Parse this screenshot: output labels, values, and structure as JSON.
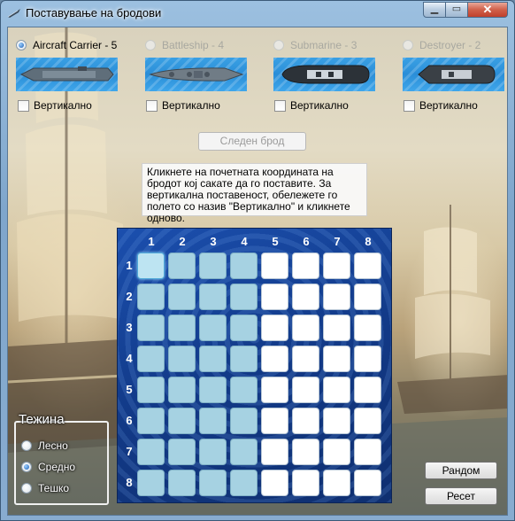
{
  "window": {
    "title": "Поставување на бродови",
    "min_label": "▁",
    "max_label": "▭",
    "close_label": "✕"
  },
  "ships": [
    {
      "label": "Aircraft Carrier - 5",
      "checked": true,
      "enabled": true,
      "vertical_label": "Вертикално"
    },
    {
      "label": "Battleship - 4",
      "checked": false,
      "enabled": false,
      "vertical_label": "Вертикално"
    },
    {
      "label": "Submarine - 3",
      "checked": false,
      "enabled": false,
      "vertical_label": "Вертикално"
    },
    {
      "label": "Destroyer - 2",
      "checked": false,
      "enabled": false,
      "vertical_label": "Вертикално"
    }
  ],
  "next_button": "Следен брод",
  "tooltip": "Кликнете на почетната координата на бродот кој сакате да го поставите. За вертикална поставеност, обележете го полето со назив \"Вертикално\" и кликнете одново.",
  "board": {
    "columns": [
      "1",
      "2",
      "3",
      "4",
      "5",
      "6",
      "7",
      "8"
    ],
    "rows": [
      "1",
      "2",
      "3",
      "4",
      "5",
      "6",
      "7",
      "8"
    ],
    "highlighted_columns": [
      "1",
      "2",
      "3",
      "4"
    ],
    "selected_cell": "1-1"
  },
  "difficulty": {
    "title": "Тежина",
    "options": [
      {
        "label": "Лесно",
        "checked": false
      },
      {
        "label": "Средно",
        "checked": true
      },
      {
        "label": "Тешко",
        "checked": false
      }
    ]
  },
  "buttons": {
    "random": "Рандом",
    "reset": "Ресет"
  },
  "colors": {
    "water": "#2a8ed8",
    "board": "#1b4fae",
    "highlight_cell": "#a6d2e2",
    "empty_cell": "#ffffff"
  }
}
